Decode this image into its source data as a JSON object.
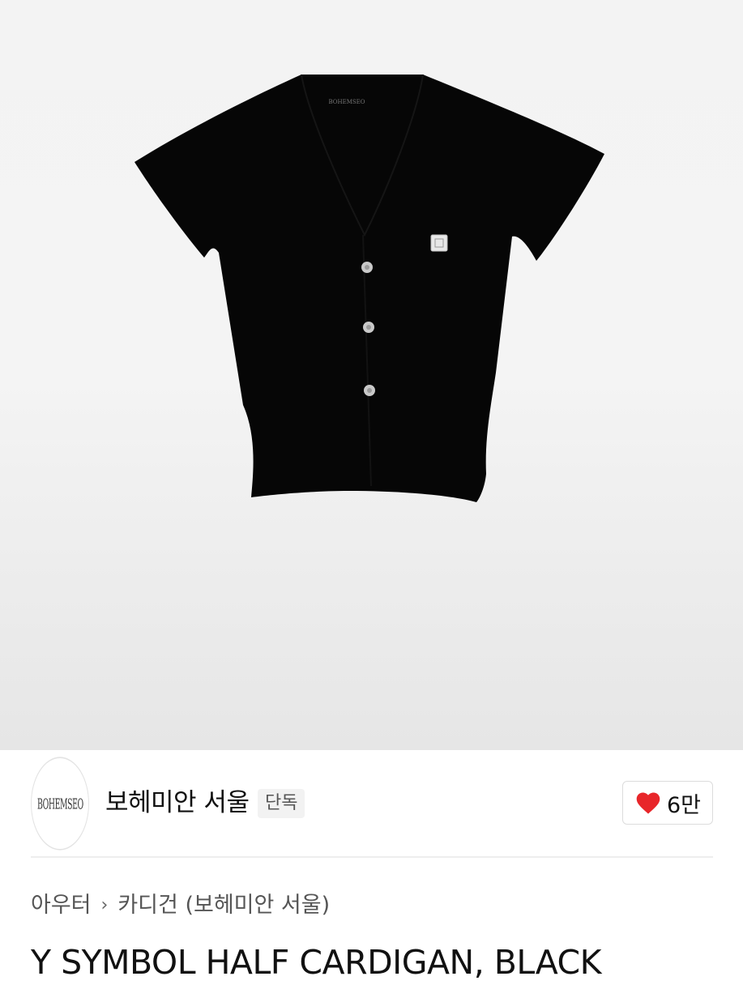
{
  "product_image": {
    "alt": "Black short-sleeve cardigan with three buttons",
    "neck_label": "BOHEMSEO"
  },
  "brand": {
    "logo_text": "BOHEMSEO",
    "name": "보헤미안 서울",
    "badge": "단독"
  },
  "like": {
    "icon": "heart-icon",
    "count": "6만",
    "color": "#e8262a"
  },
  "breadcrumb": {
    "items": [
      "아우터",
      "카디건 (보헤미안 서울)"
    ],
    "separator_icon": "chevron-right-icon"
  },
  "product": {
    "title": "Y SYMBOL HALF CARDIGAN, BLACK"
  }
}
